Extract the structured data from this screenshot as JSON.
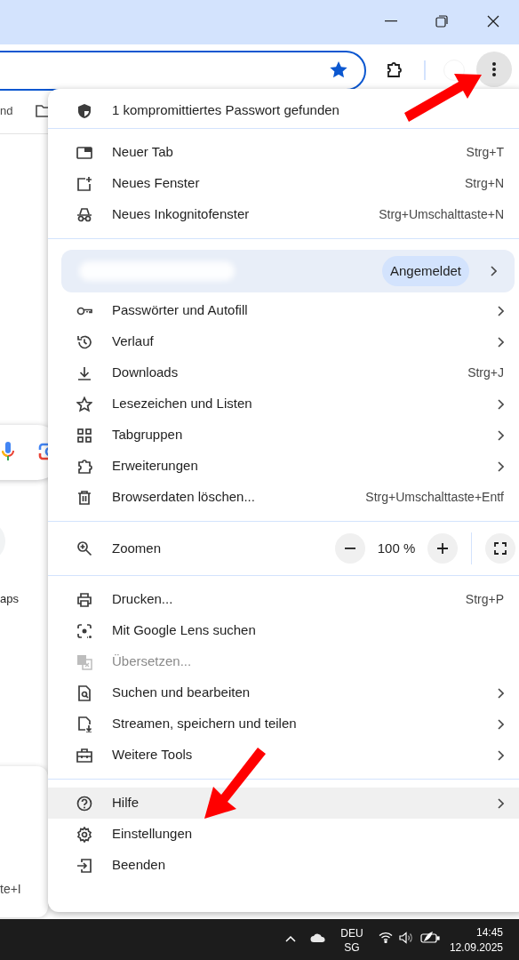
{
  "address_bar": {
    "bookmarked": true
  },
  "bookmarks_bar": {
    "items": [
      {
        "label": "nd"
      }
    ]
  },
  "page": {
    "tile_label": "aps",
    "popup_text": "te+I"
  },
  "menu": {
    "sections": [
      {
        "items": [
          {
            "kind": "alert",
            "label": "1 kompromittiertes Passwort gefunden"
          }
        ]
      },
      {
        "items": [
          {
            "kind": "item",
            "label": "Neuer Tab",
            "shortcut": "Strg+T",
            "submenu": false,
            "disabled": false,
            "highlighted": false
          },
          {
            "kind": "item",
            "label": "Neues Fenster",
            "shortcut": "Strg+N",
            "submenu": false,
            "disabled": false,
            "highlighted": false
          },
          {
            "kind": "item",
            "label": "Neues Inkognitofenster",
            "shortcut": "Strg+Umschalttaste+N",
            "submenu": false,
            "disabled": false,
            "highlighted": false
          }
        ]
      },
      {
        "items": [
          {
            "kind": "profile",
            "status": "Angemeldet",
            "submenu": true
          },
          {
            "kind": "item",
            "label": "Passwörter und Autofill",
            "submenu": true,
            "disabled": false,
            "highlighted": false
          },
          {
            "kind": "item",
            "label": "Verlauf",
            "submenu": true,
            "disabled": false,
            "highlighted": false
          },
          {
            "kind": "item",
            "label": "Downloads",
            "shortcut": "Strg+J",
            "submenu": false,
            "disabled": false,
            "highlighted": false
          },
          {
            "kind": "item",
            "label": "Lesezeichen und Listen",
            "submenu": true,
            "disabled": false,
            "highlighted": false
          },
          {
            "kind": "item",
            "label": "Tabgruppen",
            "submenu": true,
            "disabled": false,
            "highlighted": false
          },
          {
            "kind": "item",
            "label": "Erweiterungen",
            "submenu": true,
            "disabled": false,
            "highlighted": false
          },
          {
            "kind": "item",
            "label": "Browserdaten löschen...",
            "shortcut": "Strg+Umschalttaste+Entf",
            "submenu": false,
            "disabled": false,
            "highlighted": false
          }
        ]
      },
      {
        "items": [
          {
            "kind": "zoom",
            "label": "Zoomen",
            "value": "100 %"
          }
        ]
      },
      {
        "items": [
          {
            "kind": "item",
            "label": "Drucken...",
            "shortcut": "Strg+P",
            "submenu": false,
            "disabled": false,
            "highlighted": false
          },
          {
            "kind": "item",
            "label": "Mit Google Lens suchen",
            "submenu": false,
            "disabled": false,
            "highlighted": false
          },
          {
            "kind": "item",
            "label": "Übersetzen...",
            "submenu": false,
            "disabled": true,
            "highlighted": false
          },
          {
            "kind": "item",
            "label": "Suchen und bearbeiten",
            "submenu": true,
            "disabled": false,
            "highlighted": false
          },
          {
            "kind": "item",
            "label": "Streamen, speichern und teilen",
            "submenu": true,
            "disabled": false,
            "highlighted": false
          },
          {
            "kind": "item",
            "label": "Weitere Tools",
            "submenu": true,
            "disabled": false,
            "highlighted": false
          }
        ]
      },
      {
        "items": [
          {
            "kind": "item",
            "label": "Hilfe",
            "submenu": true,
            "disabled": false,
            "highlighted": true
          },
          {
            "kind": "item",
            "label": "Einstellungen",
            "submenu": false,
            "disabled": false,
            "highlighted": false
          },
          {
            "kind": "item",
            "label": "Beenden",
            "submenu": false,
            "disabled": false,
            "highlighted": false
          }
        ]
      }
    ]
  },
  "taskbar": {
    "language": "DEU",
    "layout": "SG",
    "time": "14:45",
    "date": "12.09.2025"
  }
}
